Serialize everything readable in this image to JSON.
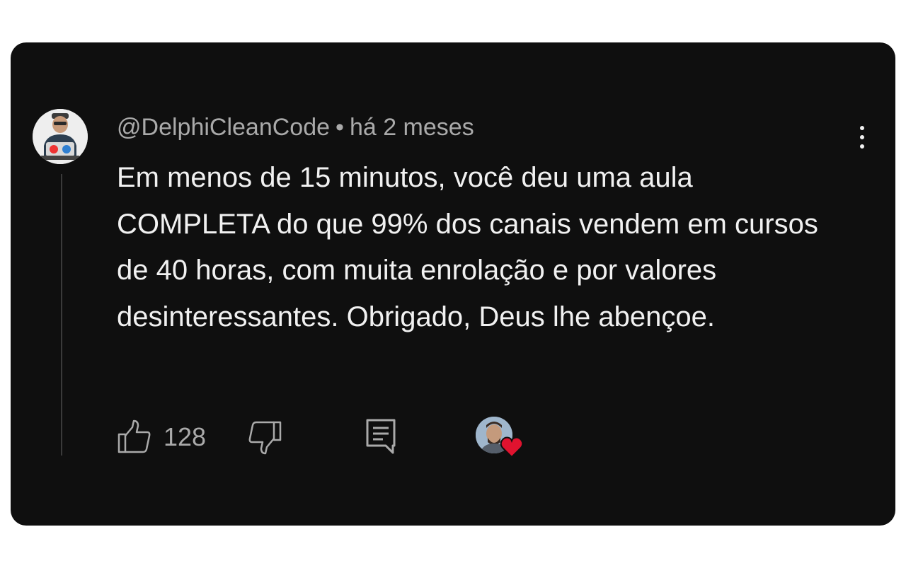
{
  "comment": {
    "author": "@DelphiCleanCode",
    "separator": "•",
    "time": "há 2 meses",
    "text": "Em menos de 15 minutos, você deu uma aula COMPLETA do que 99% dos canais vendem em cursos de 40 horas, com muita enrolação e por valores desinteressantes. Obrigado, Deus lhe abençoe.",
    "like_count": "128"
  },
  "icons": {
    "more": "more-vert-icon",
    "like": "thumb-up-icon",
    "dislike": "thumb-down-icon",
    "reply": "reply-comment-icon",
    "heart": "heart-icon"
  },
  "colors": {
    "background": "#0f0f0f",
    "text_primary": "#f1f1f1",
    "text_secondary": "#aaaaaa",
    "heart": "#e0132f"
  }
}
